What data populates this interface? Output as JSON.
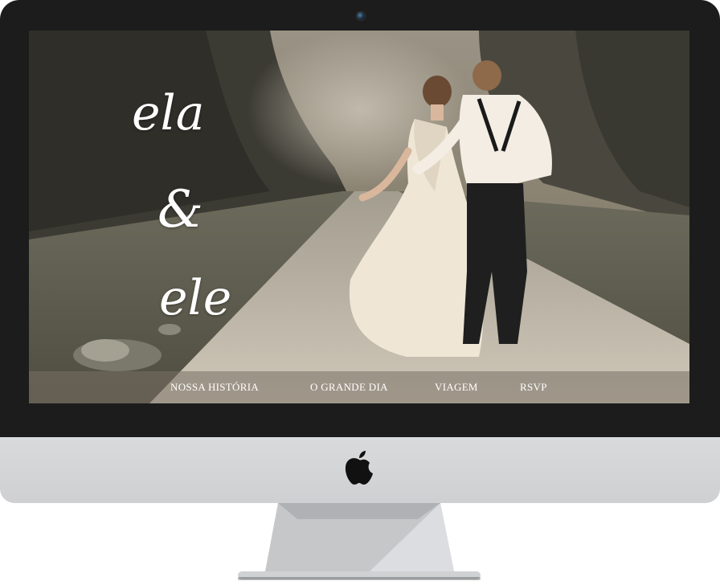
{
  "site": {
    "title_lines": [
      "ela",
      "&",
      "ele"
    ]
  },
  "nav": {
    "items": [
      {
        "label": "NOSSA HISTÓRIA"
      },
      {
        "label": "O GRANDE DIA"
      },
      {
        "label": "VIAGEM"
      },
      {
        "label": "RSVP"
      }
    ]
  },
  "hero": {
    "image": "wedding-couple-photo"
  },
  "device": {
    "logo": "apple-icon",
    "camera": "camera-icon"
  },
  "colors": {
    "bezel": "#1c1c1c",
    "chin": "#d4d5d7",
    "nav_overlay": "#787064",
    "text": "#ffffff"
  }
}
